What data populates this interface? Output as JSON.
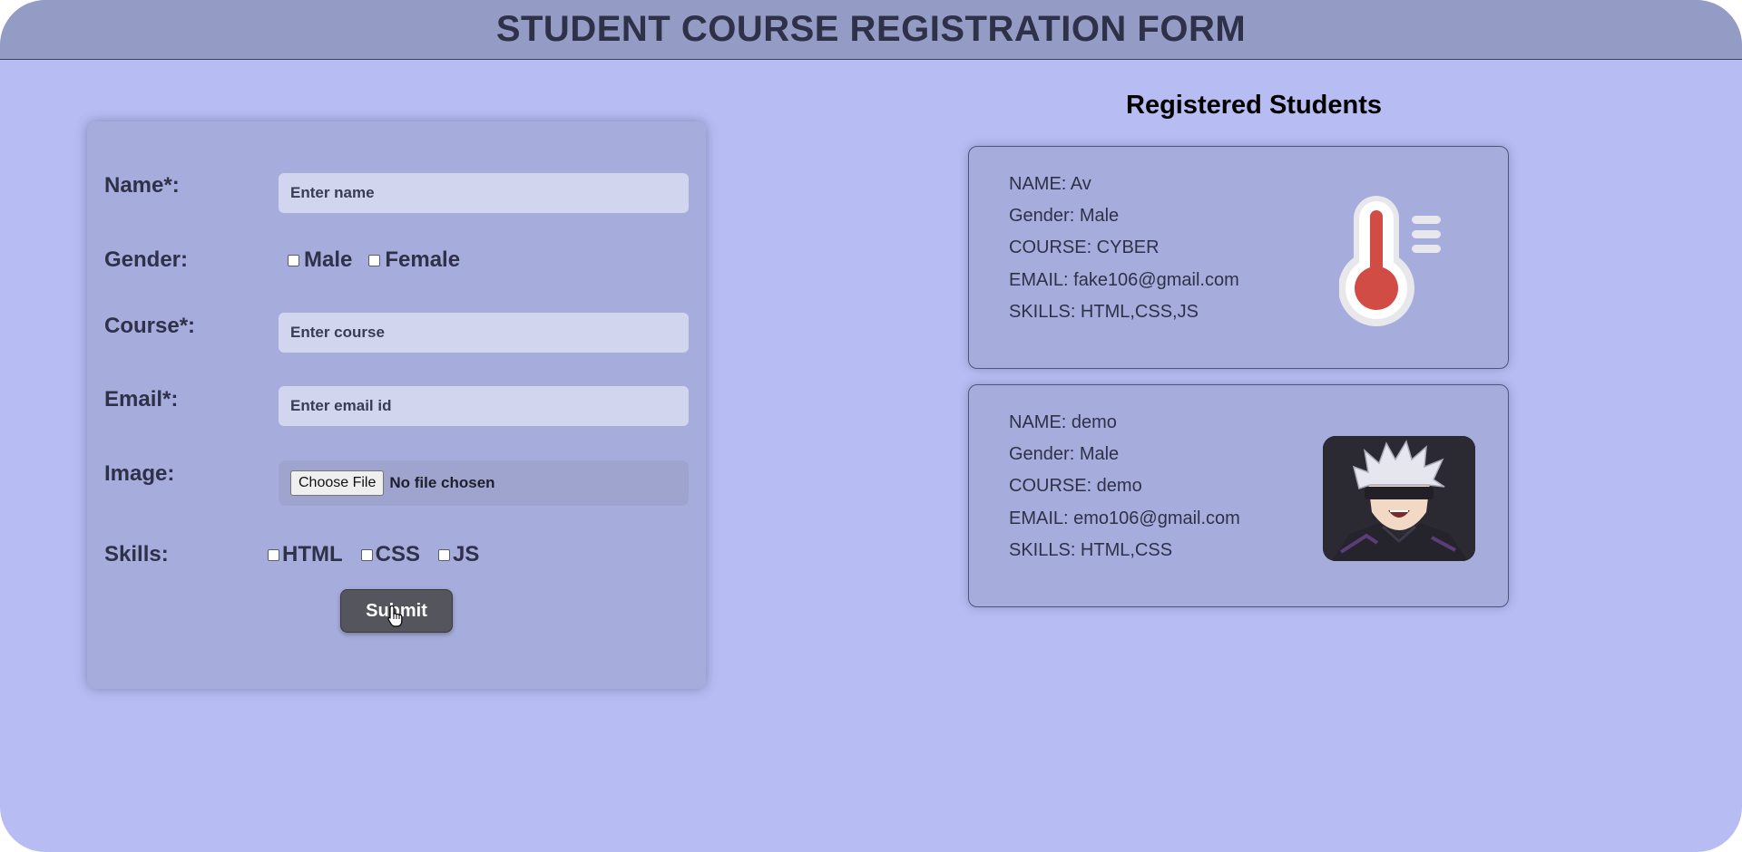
{
  "header": {
    "title": "STUDENT COURSE REGISTRATION FORM"
  },
  "form": {
    "name_label": "Name*:",
    "name_placeholder": "Enter name",
    "gender_label": "Gender:",
    "gender_options": [
      "Male",
      "Female"
    ],
    "course_label": "Course*:",
    "course_placeholder": "Enter course",
    "email_label": "Email*:",
    "email_placeholder": "Enter email id",
    "image_label": "Image:",
    "file_button": "Choose File",
    "file_status": "No file chosen",
    "skills_label": "Skills:",
    "skills_options": [
      "HTML",
      "CSS",
      "JS"
    ],
    "submit_label": "Submit"
  },
  "registered": {
    "title": "Registered Students",
    "students": [
      {
        "name": "NAME: Av",
        "gender": "Gender: Male",
        "course": "COURSE: CYBER",
        "email": "EMAIL: fake106@gmail.com",
        "skills": "SKILLS: HTML,CSS,JS",
        "image_icon": "thermometer-icon"
      },
      {
        "name": "NAME: demo",
        "gender": "Gender: Male",
        "course": "COURSE: demo",
        "email": "EMAIL: emo106@gmail.com",
        "skills": "SKILLS: HTML,CSS",
        "image_icon": "anime-character-photo"
      }
    ]
  },
  "colors": {
    "background": "#b7bdf2",
    "header": "#949bc5",
    "card": "#a6acdb",
    "input": "#d1d5ee",
    "submit": "#54555d",
    "thermometer": "#d14c45"
  }
}
